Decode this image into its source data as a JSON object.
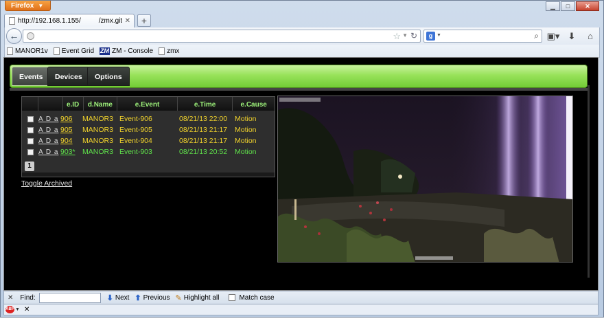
{
  "browser": {
    "app_button": "Firefox",
    "window_controls": {
      "minimize": "▁",
      "maximize": "□",
      "close": "✕"
    }
  },
  "tab": {
    "title": "http://192.168.1.155/",
    "title_tail": "/zmx.git/",
    "close": "✕",
    "new_tab": "+"
  },
  "navbar": {
    "url_value": "",
    "search_engine_icon": "g",
    "search_value": "",
    "icons": [
      "back-icon",
      "globe-icon",
      "star-icon",
      "reload-icon",
      "search-icon",
      "bookmarks-menu-icon",
      "download-icon",
      "home-icon"
    ]
  },
  "bookmarks": [
    {
      "label": "MANOR1v",
      "icon": "page"
    },
    {
      "label": "Event Grid",
      "icon": "page"
    },
    {
      "label": "ZM - Console",
      "icon": "zm",
      "icon_text": "ZM"
    },
    {
      "label": "zmx",
      "icon": "page"
    }
  ],
  "zm": {
    "tabs": [
      "Events",
      "Devices",
      "Options"
    ],
    "active_tab": "Events",
    "columns": [
      "",
      "",
      "e.ID",
      "d.Name",
      "e.Event",
      "e.Time",
      "e.Cause"
    ],
    "rows": [
      {
        "actions": "A D a",
        "id": "906",
        "name": "MANOR3",
        "event": "Event-906",
        "time": "08/21/13 22:00",
        "cause": "Motion",
        "selected": false
      },
      {
        "actions": "A D a",
        "id": "905",
        "name": "MANOR3",
        "event": "Event-905",
        "time": "08/21/13 21:17",
        "cause": "Motion",
        "selected": false
      },
      {
        "actions": "A D a",
        "id": "904",
        "name": "MANOR3",
        "event": "Event-904",
        "time": "08/21/13 21:17",
        "cause": "Motion",
        "selected": false
      },
      {
        "actions": "A D a",
        "id": "903*",
        "name": "MANOR3",
        "event": "Event-903",
        "time": "08/21/13 20:52",
        "cause": "Motion",
        "selected": true
      }
    ],
    "page": "1",
    "toggle_archived": "Toggle Archived",
    "colors": {
      "row_text": "#f0d22c",
      "selected_text": "#5fe04a",
      "header_text": "#9df27a",
      "accent_green": "#72cc36"
    }
  },
  "findbar": {
    "close": "✕",
    "label": "Find:",
    "value": "",
    "next": "Next",
    "previous": "Previous",
    "highlight_all": "Highlight all",
    "match_case": "Match case"
  },
  "addonbar": {
    "abp": "ABP",
    "close": "✕"
  }
}
